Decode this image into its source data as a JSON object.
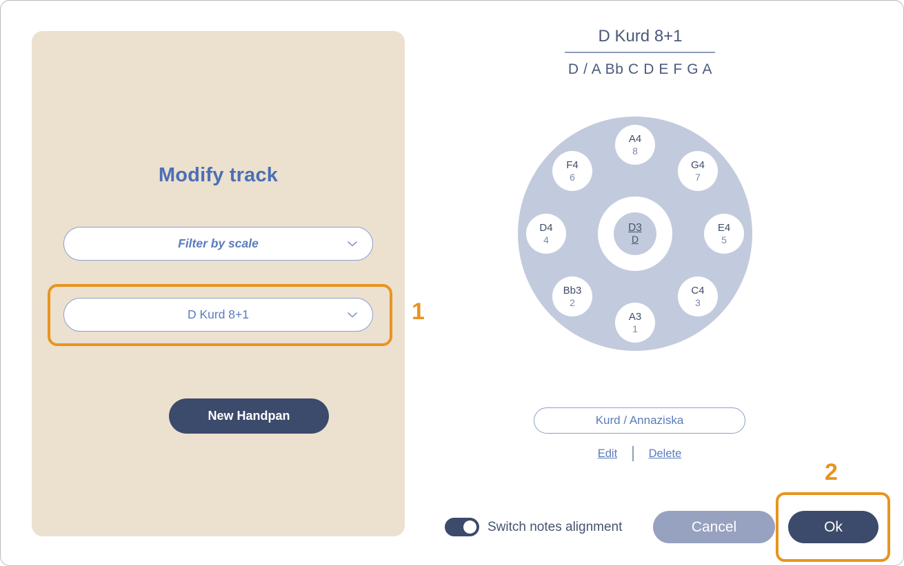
{
  "left_panel": {
    "title": "Modify track",
    "filter_select": {
      "value": "Filter by scale",
      "icon": "chevron-down-icon"
    },
    "scale_select": {
      "value": "D Kurd 8+1",
      "icon": "chevron-down-icon"
    },
    "new_handpan_button": "New Handpan"
  },
  "right_panel": {
    "scale_title": "D Kurd 8+1",
    "scale_notes": "D / A Bb C D E F G A",
    "handpan": {
      "center": {
        "note": "D3",
        "sub": "D"
      },
      "notes": [
        {
          "note": "A4",
          "number": "8"
        },
        {
          "note": "G4",
          "number": "7"
        },
        {
          "note": "E4",
          "number": "5"
        },
        {
          "note": "C4",
          "number": "3"
        },
        {
          "note": "A3",
          "number": "1"
        },
        {
          "note": "Bb3",
          "number": "2"
        },
        {
          "note": "D4",
          "number": "4"
        },
        {
          "note": "F4",
          "number": "6"
        }
      ]
    },
    "scale_name_pill": "Kurd / Annaziska",
    "edit_link": "Edit",
    "delete_link": "Delete"
  },
  "footer": {
    "toggle_label": "Switch notes alignment",
    "toggle_state": "on",
    "cancel_button": "Cancel",
    "ok_button": "Ok"
  },
  "annotations": {
    "marker_1": "1",
    "marker_2": "2"
  },
  "colors": {
    "panel_beige": "#ece0cf",
    "navy": "#3c4a6b",
    "accent_blue": "#4a6fb5",
    "highlight_orange": "#e8941f",
    "handpan_blue": "#c2cbdd",
    "cancel_gray": "#97a2c0"
  }
}
